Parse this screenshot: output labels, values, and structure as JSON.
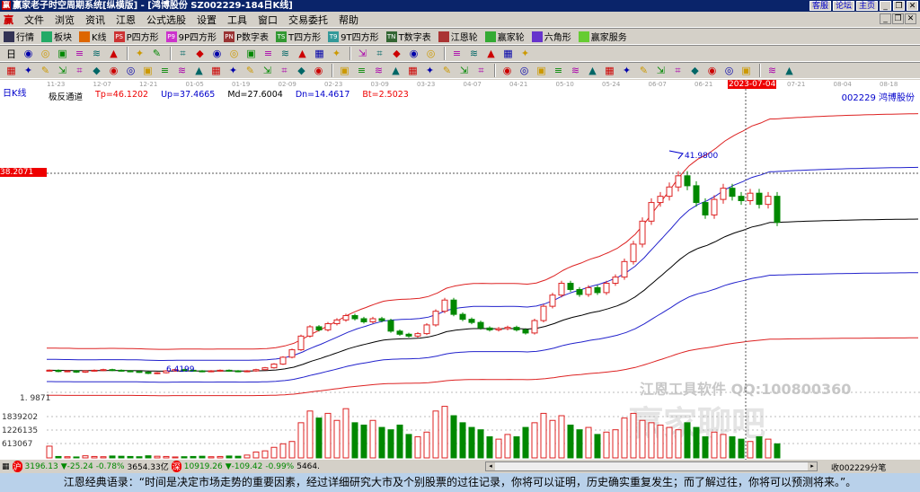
{
  "title": "赢家老子时空周期系统[纵横版] - [鸿博股份  SZ002229-184日K线]",
  "title_buttons": [
    "客服",
    "论坛",
    "主页"
  ],
  "menu": [
    "文件",
    "浏览",
    "资讯",
    "江恩",
    "公式选股",
    "设置",
    "工具",
    "窗口",
    "交易委托",
    "帮助"
  ],
  "toolbar1": [
    {
      "label": "行情",
      "icon": "quote-icon",
      "color": "#335"
    },
    {
      "label": "板块",
      "icon": "sector-icon",
      "color": "#2a6"
    },
    {
      "label": "K线",
      "icon": "kline-icon",
      "color": "#d60"
    },
    {
      "label": "P四方形",
      "icon": "p-square-icon",
      "color": "#c33",
      "tag": "PS"
    },
    {
      "label": "9P四方形",
      "icon": "9p-square-icon",
      "color": "#c3c",
      "tag": "P9"
    },
    {
      "label": "P数字表",
      "icon": "p-number-table-icon",
      "color": "#933",
      "tag": "PN"
    },
    {
      "label": "T四方形",
      "icon": "t-square-icon",
      "color": "#393",
      "tag": "TS"
    },
    {
      "label": "9T四方形",
      "icon": "9t-square-icon",
      "color": "#399",
      "tag": "T9"
    },
    {
      "label": "T数字表",
      "icon": "t-number-table-icon",
      "color": "#363",
      "tag": "TN"
    },
    {
      "label": "江恩轮",
      "icon": "gann-wheel-icon",
      "color": "#a33"
    },
    {
      "label": "赢家轮",
      "icon": "winner-wheel-icon",
      "color": "#3a3"
    },
    {
      "label": "六角形",
      "icon": "hexagon-icon",
      "color": "#63c"
    },
    {
      "label": "赢家服务",
      "icon": "dollar-service-icon",
      "color": "#6c3"
    }
  ],
  "toolbar2": [
    "日",
    "period-dropdown-icon",
    "zoom-chart-icon",
    "self-select-icon",
    "indicator-a-icon",
    "indicator-b-icon",
    "cursor-dropdown-icon",
    "|",
    "restore-icon",
    "flag-icon",
    "|",
    "first-bar-icon",
    "last-bar-icon",
    "prev-icon",
    "next-icon",
    "diamond-1-icon",
    "diamond-2-icon",
    "diamond-3-icon",
    "diamond-4-icon",
    "diamond-5-icon",
    "diamond-6-icon",
    "|",
    "hand-icon",
    "crosshair-icon",
    "line-draw-icon",
    "cycle-icon",
    "fib-icon",
    "|",
    "calendar-icon",
    "calculator-icon",
    "notes-icon",
    "save-icon",
    "export-icon"
  ],
  "toolbar3": [
    "pen-icon",
    "grid-icon",
    "gann-fan-a-icon",
    "gann-fan-b-icon",
    "fork-icon",
    "arc-icon",
    "brush-icon",
    "circle-line-icon",
    "parallel-icon",
    "speed-line-icon",
    "triangle-icon",
    "target-icon",
    "star-icon",
    "box-icon",
    "wave-icon",
    "red-box-icon",
    "red-grid-icon",
    "bars-icon",
    "channel-icon",
    "|",
    "rect-icon",
    "fan-lines-icon",
    "square-grid-icon",
    "cross-grid-icon",
    "angle-icon",
    "v-icon",
    "dot-grid-icon",
    "diag-grid-icon",
    "multi-line-icon",
    "|",
    "ruler-icon",
    "pct-red-icon",
    "percent-icon",
    "pct-line-icon",
    "gold-coin-icon",
    "gold-line-icon",
    "tool-icon",
    "red-line-icon",
    "gold-box-icon",
    "fan-a-icon",
    "fan-b-icon",
    "fan-c-icon",
    "fan-d-icon",
    "fan-e-icon",
    "fan-f-icon",
    "|",
    "yin-yang-icon",
    "infinity-icon"
  ],
  "chart": {
    "period_label": "日K线",
    "dates": [
      "11-23",
      "12-07",
      "12-21",
      "01-05",
      "01-19",
      "02-09",
      "02-23",
      "03-09",
      "03-23",
      "04-07",
      "04-21",
      "05-10",
      "05-24",
      "06-07",
      "06-21",
      "2023-07-04",
      "07-21",
      "08-04",
      "08-18"
    ],
    "indicator": {
      "name": "极反通道",
      "tp": "Tp=46.1202",
      "up": "Up=37.4665",
      "md": "Md=27.6004",
      "dn": "Dn=14.4617",
      "bt": "Bt=2.5023"
    },
    "stock": "002229  鸿博股份",
    "cursor_price": "38.2071",
    "high_label": "41.9800",
    "low_label": "6.4199",
    "price_axis_low": "1. 9871",
    "vol_axis": [
      "1839202",
      "1226135",
      "613067"
    ],
    "watermark1": "江恩工具软件  QQ:100800360",
    "watermark2": "赢家聊吧"
  },
  "chart_data": {
    "type": "candlestick",
    "closes": [
      6.5,
      6.3,
      6.4,
      6.2,
      6.4,
      6.5,
      6.6,
      6.5,
      6.4,
      6.3,
      6.2,
      6.0,
      6.1,
      6.4,
      6.6,
      6.5,
      6.4,
      6.3,
      6.4,
      6.5,
      6.4,
      6.3,
      6.4,
      6.6,
      6.9,
      7.5,
      8.6,
      9.8,
      12.0,
      13.5,
      13.0,
      14.0,
      14.6,
      15.3,
      14.8,
      14.3,
      14.8,
      14.5,
      12.8,
      12.3,
      12.0,
      12.4,
      13.8,
      16.0,
      17.8,
      15.5,
      14.7,
      14.2,
      13.3,
      13.0,
      13.2,
      13.4,
      13.0,
      12.5,
      14.5,
      16.8,
      18.6,
      20.5,
      19.5,
      18.7,
      19.8,
      19.0,
      20.5,
      21.5,
      24.0,
      26.8,
      30.5,
      33.5,
      34.5,
      36.0,
      37.8,
      36.2,
      33.5,
      31.5,
      34.0,
      35.8,
      34.5,
      33.8,
      35.0,
      33.2,
      34.5,
      30.3
    ],
    "volumes": [
      500000,
      60000,
      50000,
      40000,
      90000,
      60000,
      50000,
      80000,
      70000,
      60000,
      50000,
      90000,
      70000,
      60000,
      40000,
      50000,
      60000,
      70000,
      50000,
      60000,
      80000,
      70000,
      120000,
      250000,
      300000,
      450000,
      600000,
      700000,
      1500000,
      2000000,
      1700000,
      1900000,
      1600000,
      2100000,
      1500000,
      1400000,
      1600000,
      1300000,
      1200000,
      1400000,
      1000000,
      900000,
      1100000,
      2000000,
      2200000,
      1800000,
      1500000,
      1300000,
      1200000,
      900000,
      800000,
      1000000,
      900000,
      1300000,
      1500000,
      1900000,
      1600000,
      1800000,
      1400000,
      1200000,
      1300000,
      1000000,
      1100000,
      1200000,
      1700000,
      1900000,
      1600000,
      1500000,
      1400000,
      1300000,
      1200000,
      1500000,
      1300000,
      900000,
      1100000,
      1000000,
      900000,
      800000,
      700000,
      900000,
      800000,
      600000
    ]
  },
  "status": {
    "sh_icon": "沪",
    "sh_index": "3196.13",
    "sh_change": "▼-25.24",
    "sh_pct": "-0.78%",
    "sh_amount": "3654.33亿",
    "sz_icon": "深",
    "sz_index": "10919.26",
    "sz_change": "▼-109.42",
    "sz_pct": "-0.99%",
    "sz_amount": "5464.",
    "tick": "收002229分笔"
  },
  "quote": "江恩经典语录：“时间是决定市场走势的重要因素，经过详细研究大市及个别股票的过往记录，你将可以证明，历史确实重复发生；而了解过往，你将可以预测将来。”。"
}
